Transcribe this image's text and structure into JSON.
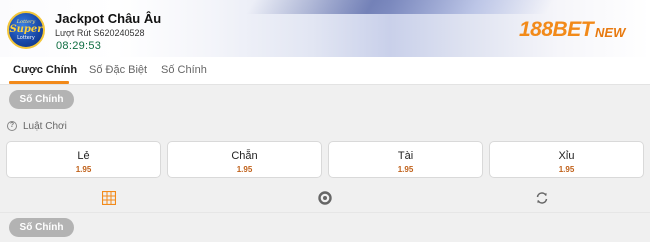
{
  "header": {
    "logo": {
      "line1": "Lottery",
      "line2": "Super",
      "line3": "Lottery"
    },
    "title": "Jackpot Châu Âu",
    "draw_label": "Lượt Rút S620240528",
    "timer": "08:29:53",
    "brand": {
      "part1": "188",
      "part2": "BET",
      "part3": "NEW"
    }
  },
  "tabs": [
    {
      "label": "Cược Chính",
      "active": true
    },
    {
      "label": "Số Đặc Biệt",
      "active": false
    },
    {
      "label": "Số Chính",
      "active": false
    }
  ],
  "section_pill_top": "Số Chính",
  "rules_label": "Luật Chơi",
  "options": [
    {
      "name": "Lẻ",
      "odds": "1.95"
    },
    {
      "name": "Chẵn",
      "odds": "1.95"
    },
    {
      "name": "Tài",
      "odds": "1.95"
    },
    {
      "name": "Xỉu",
      "odds": "1.95"
    }
  ],
  "icons": [
    "grid-icon",
    "circle-icon",
    "refresh-icon"
  ],
  "section_pill_bottom": "Số Chính",
  "colors": {
    "accent": "#f28a1a",
    "odds": "#c0611a",
    "timer": "#0f6e42",
    "pill": "#b3b3b3"
  }
}
